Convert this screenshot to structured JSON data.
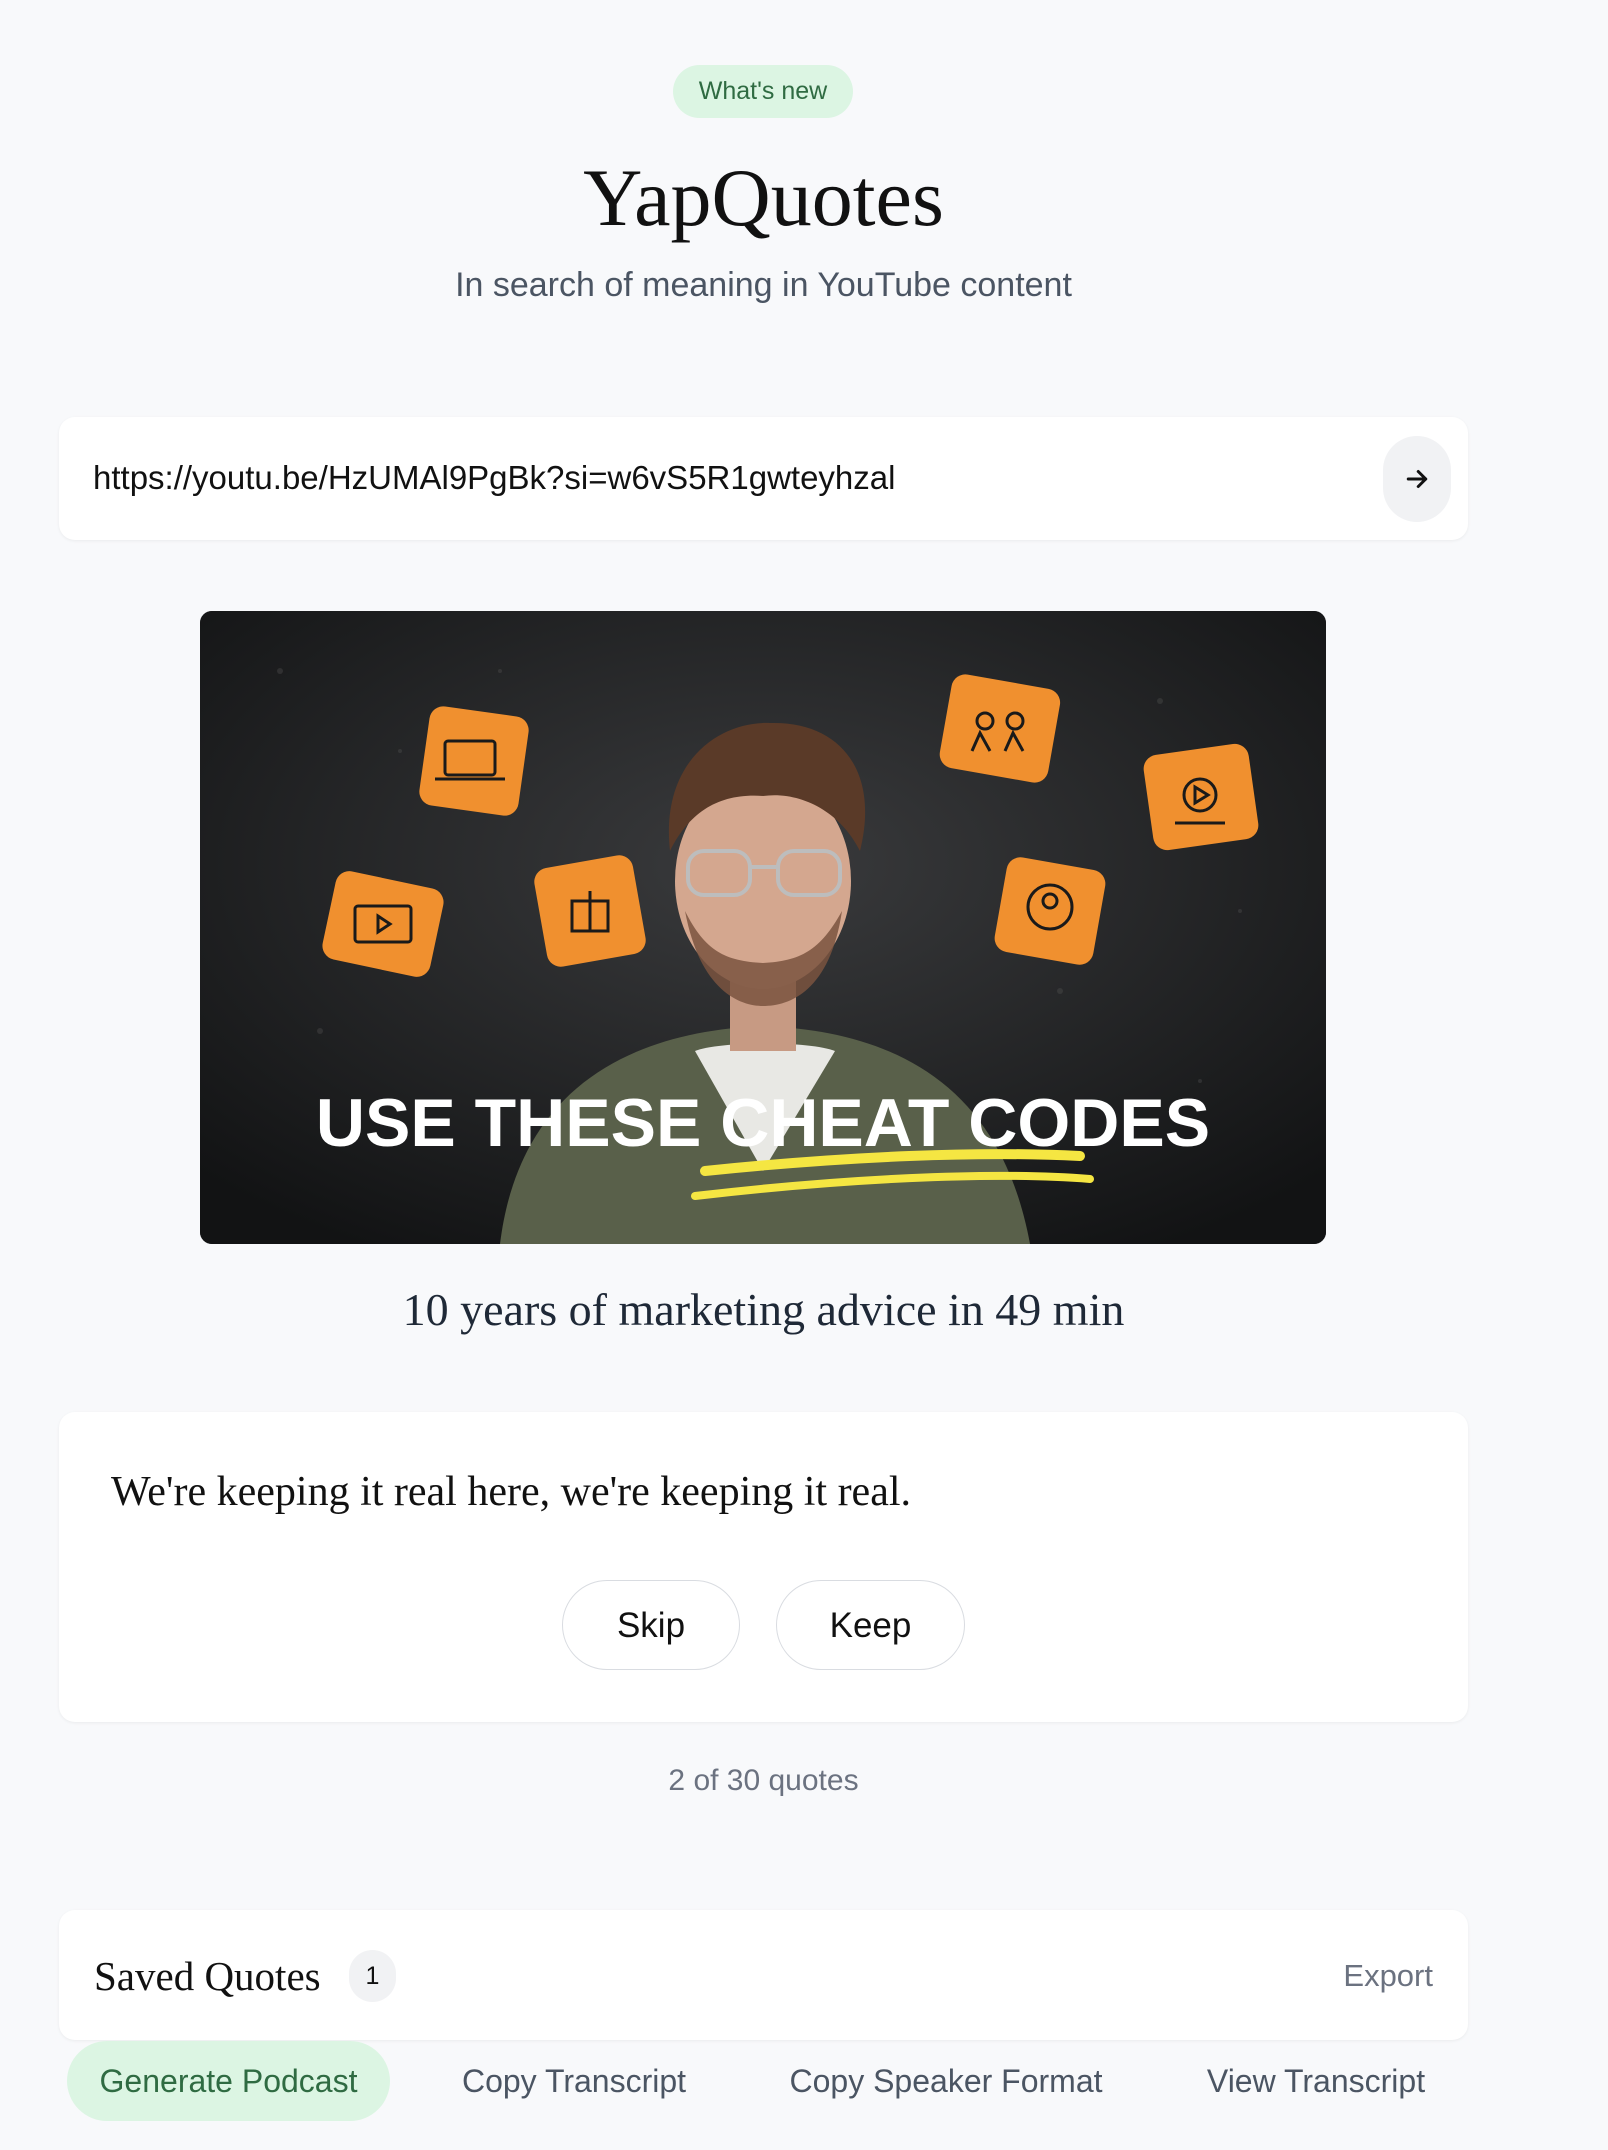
{
  "header": {
    "badge": "What's new",
    "title": "YapQuotes",
    "subtitle": "In search of meaning in YouTube content"
  },
  "url_bar": {
    "value": "https://youtu.be/HzUMAl9PgBk?si=w6vS5R1gwteyhzal",
    "submit_icon": "arrow-right-icon"
  },
  "video": {
    "thumbnail_text": "USE THESE CHEAT CODES",
    "title": "10 years of marketing advice in 49 min",
    "colors": {
      "tile": "#f0902f",
      "underline": "#f5e642",
      "background": "#1a1b1d"
    }
  },
  "quote_card": {
    "text": "We're keeping it real here, we're keeping it real.",
    "skip_label": "Skip",
    "keep_label": "Keep"
  },
  "progress": {
    "text": "2 of 30 quotes",
    "current": 2,
    "total": 30
  },
  "saved": {
    "title": "Saved Quotes",
    "count": "1",
    "export_label": "Export"
  },
  "actions": {
    "generate_podcast": "Generate Podcast",
    "copy_transcript": "Copy Transcript",
    "copy_speaker_format": "Copy Speaker Format",
    "view_transcript": "View Transcript"
  },
  "colors": {
    "page_bg": "#f8f9fb",
    "accent_green_bg": "#dcf5e3",
    "accent_green_text": "#2f6b42"
  }
}
